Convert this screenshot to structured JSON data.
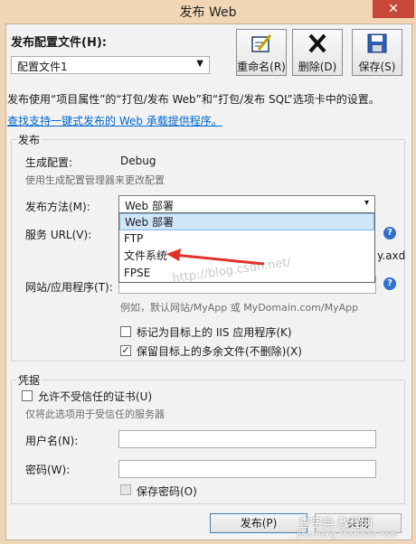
{
  "window": {
    "title": "发布 Web",
    "close_glyph": "✕"
  },
  "profile": {
    "label": "发布配置文件(H):",
    "selected": "配置文件1"
  },
  "toolbar": {
    "rename": "重命名(R)",
    "delete": "删除(D)",
    "save": "保存(S)"
  },
  "description": "发布使用“项目属性”的“打包/发布 Web”和“打包/发布 SQL”选项卡中的设置。",
  "link": "查找支持一键式发布的 Web 承载提供程序。",
  "publish": {
    "group_title": "发布",
    "build_config_label": "生成配置:",
    "build_config_value": "Debug",
    "build_config_hint": "使用生成配置管理器来更改配置",
    "method_label": "发布方法(M):",
    "method_selected": "Web 部署",
    "method_options": [
      "Web 部署",
      "FTP",
      "文件系统",
      "FPSE"
    ],
    "service_url_label": "服务 URL(V):",
    "service_url_hint": "y.axd",
    "site_label": "网站/应用程序(T):",
    "site_hint": "例如，默认网站/MyApp 或 MyDomain.com/MyApp",
    "iis_app_label": "标记为目标上的 IIS 应用程序(K)",
    "iis_app_checked": false,
    "keep_files_label": "保留目标上的多余文件(不删除)(X)",
    "keep_files_checked": true
  },
  "credentials": {
    "group_title": "凭据",
    "untrusted_cert_label": "允许不受信任的证书(U)",
    "untrusted_cert_hint": "仅将此选项用于受信任的服务器",
    "username_label": "用户名(N):",
    "password_label": "密码(W):",
    "save_password_label": "保存密码(O)"
  },
  "buttons": {
    "publish": "发布(P)",
    "close": "关闭"
  },
  "watermark": {
    "blog": "http://blog.csdn.net/",
    "site": "查字典 教程网",
    "site_url": "jiaocheng.chazidian.com"
  },
  "colors": {
    "title_bar": "#f1d5b5",
    "close_button": "#c7473a",
    "link": "#0066cc",
    "dropdown_selection": "#cfe6fb",
    "arrow": "#e0322c"
  }
}
